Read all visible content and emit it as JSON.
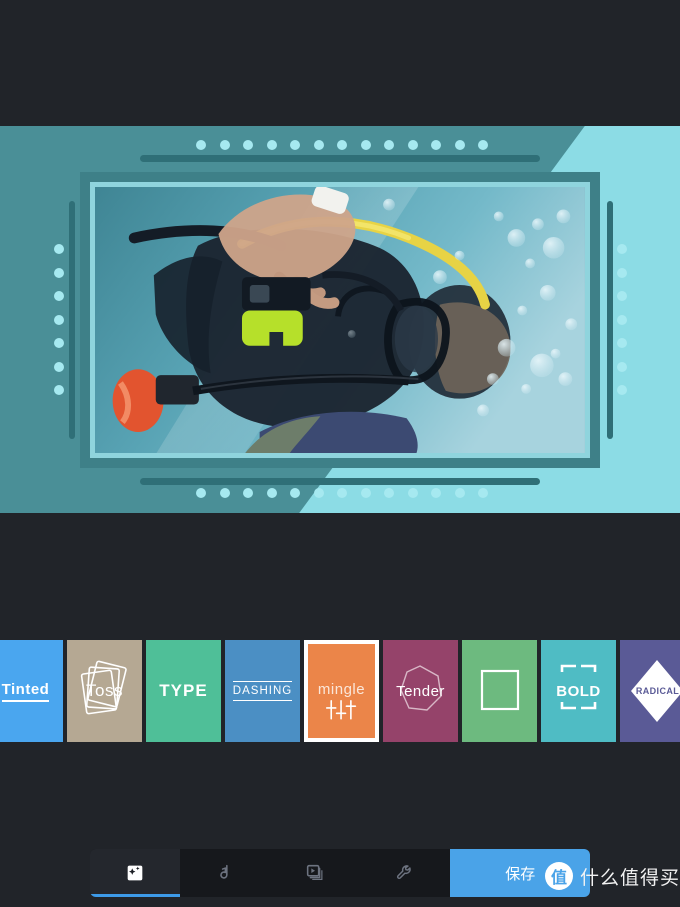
{
  "app": {
    "background_color": "#212429",
    "canvas_background": "#4a8f97",
    "canvas_highlight": "#8cdce5",
    "accent_color": "#4aa3e8"
  },
  "canvas": {
    "name": "photo-preview",
    "frame_border_color": "#3e8088",
    "frame_inner_color": "#8fd4dd",
    "dot_color": "#a6e9f0",
    "bar_color": "#2f6f77",
    "top_dots": 13,
    "bottom_dots": 13,
    "left_dots": 7,
    "right_dots": 7,
    "photo_alt": "underwater scuba diver holding camera with air bubbles, rotated 90 degrees"
  },
  "filters": {
    "selected_index": 4,
    "items": [
      {
        "label": "Tinted",
        "color": "#4aa6ef",
        "icon": "underline-text",
        "style": "tinted"
      },
      {
        "label": "Toss",
        "color": "#b5a893",
        "icon": "cards-icon",
        "style": "toss"
      },
      {
        "label": "TYPE",
        "color": "#4fbf98",
        "icon": "none",
        "style": "type"
      },
      {
        "label": "DASHING",
        "color": "#4b8fc4",
        "icon": "rules-icon",
        "style": "dashing"
      },
      {
        "label": "mingle",
        "color": "#eb8549",
        "icon": "sliders-icon",
        "style": "mingle"
      },
      {
        "label": "Tender",
        "color": "#95436a",
        "icon": "heptagon-icon",
        "style": "tender"
      },
      {
        "label": "",
        "color": "#6dba7f",
        "icon": "square-icon",
        "style": "square"
      },
      {
        "label": "BOLD",
        "color": "#4fbcc4",
        "icon": "brackets-icon",
        "style": "bold"
      },
      {
        "label": "RADICAL",
        "color": "#5a5a96",
        "icon": "diamond-icon",
        "style": "radical"
      }
    ]
  },
  "navbar": {
    "items": [
      {
        "name": "effects-tab",
        "icon": "magic-wand-icon",
        "active": true
      },
      {
        "name": "music-tab",
        "icon": "music-note-icon",
        "active": false
      },
      {
        "name": "frames-tab",
        "icon": "video-frames-icon",
        "active": false
      },
      {
        "name": "tools-tab",
        "icon": "wrench-icon",
        "active": false
      }
    ],
    "save_label": "保存"
  },
  "watermark": {
    "badge_text": "值",
    "text": "什么值得买"
  }
}
